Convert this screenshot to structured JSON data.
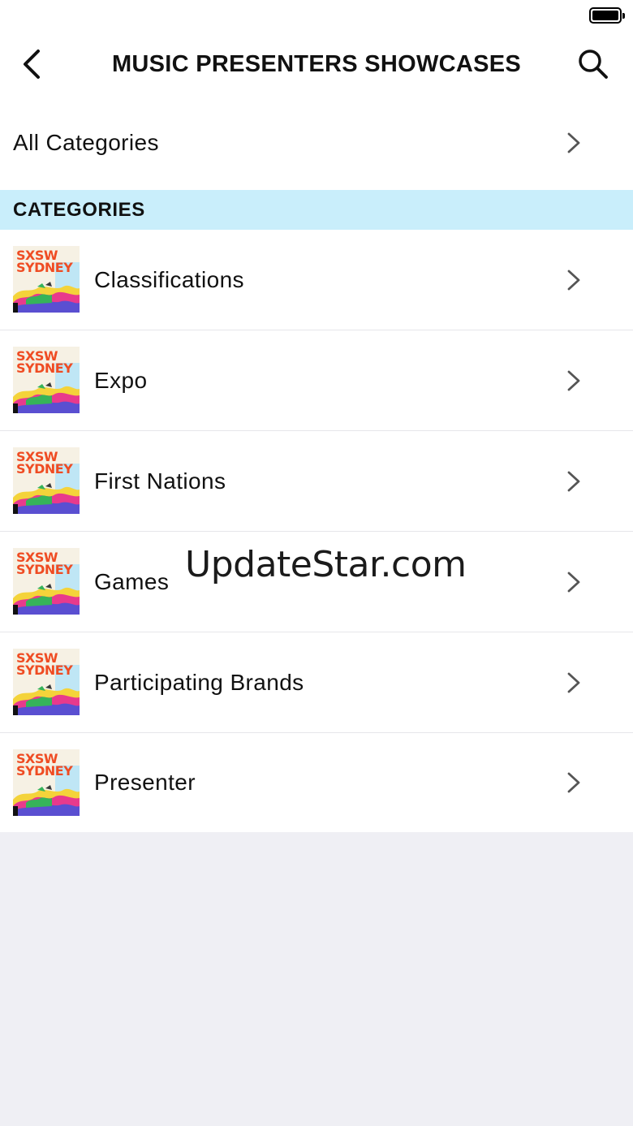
{
  "nav": {
    "title": "MUSIC PRESENTERS SHOWCASES"
  },
  "all_categories": {
    "label": "All Categories"
  },
  "section": {
    "title": "CATEGORIES"
  },
  "categories": [
    {
      "label": "Classifications",
      "thumb_text": "SXSW SYDNEY"
    },
    {
      "label": "Expo",
      "thumb_text": "SXSW SYDNEY"
    },
    {
      "label": "First Nations",
      "thumb_text": "SXSW SYDNEY"
    },
    {
      "label": "Games",
      "thumb_text": "SXSW SYDNEY"
    },
    {
      "label": "Participating Brands",
      "thumb_text": "SXSW SYDNEY"
    },
    {
      "label": "Presenter",
      "thumb_text": "SXSW SYDNEY"
    }
  ],
  "watermark": "UpdateStar.com",
  "battery_level": 1.0,
  "colors": {
    "section_bg": "#c9eefb",
    "page_bg": "#efeff4",
    "logo_orange": "#ef4c23"
  },
  "icons": [
    "chevron-left-icon",
    "search-icon",
    "chevron-right-icon",
    "battery-icon"
  ]
}
